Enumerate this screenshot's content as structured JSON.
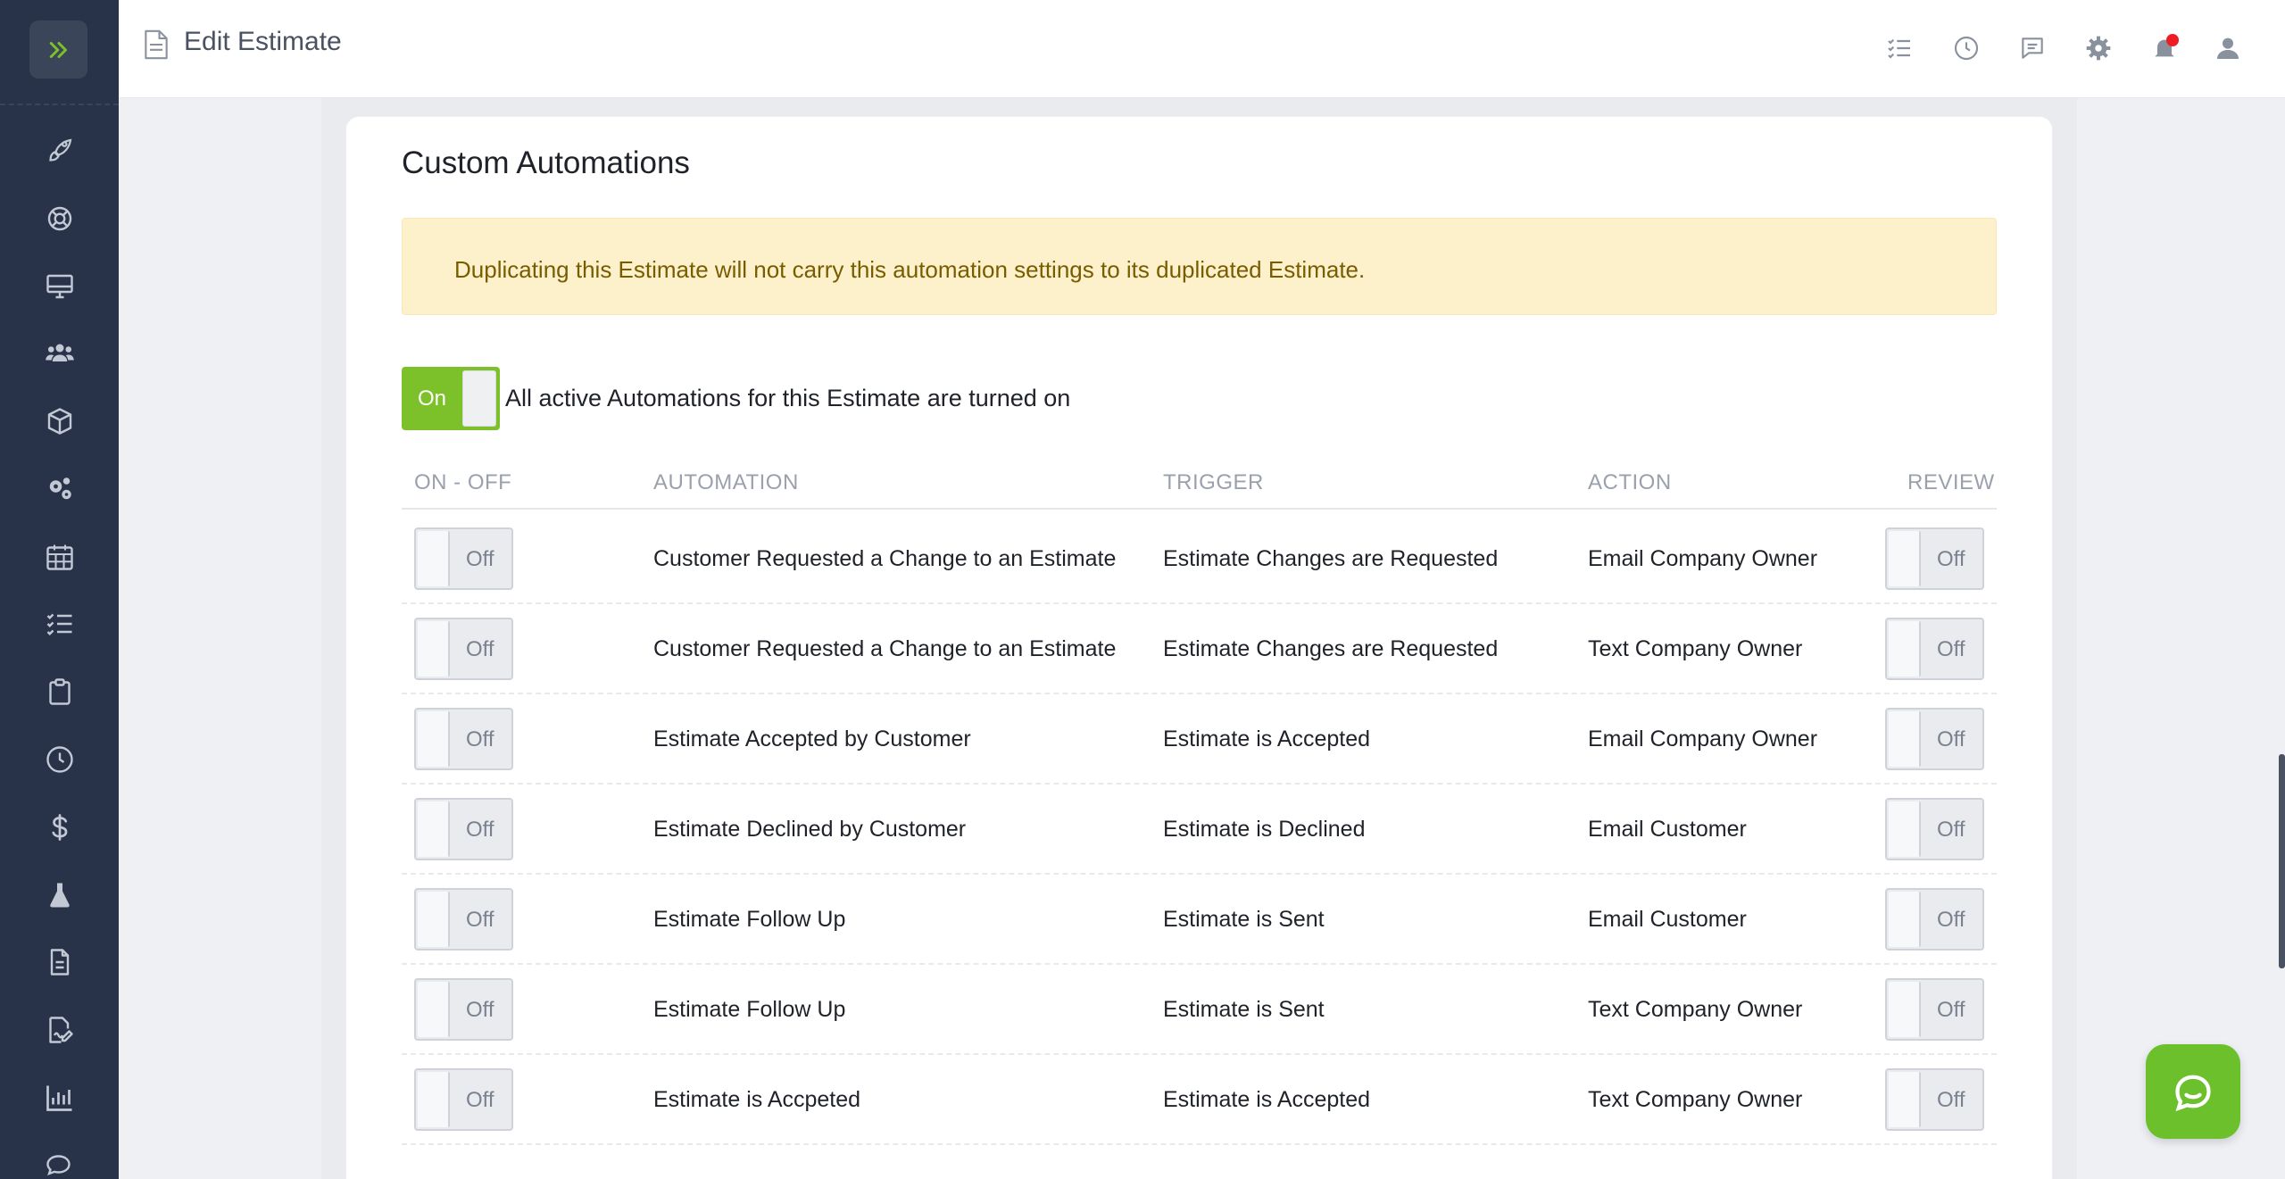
{
  "header": {
    "title": "Edit Estimate",
    "icons": [
      "checklist-icon",
      "history-icon",
      "chat-icon",
      "settings-icon",
      "bell-icon",
      "user-icon"
    ]
  },
  "sidebar": {
    "items": [
      "expand-icon",
      "rocket-icon",
      "lifebuoy-icon",
      "monitor-icon",
      "users-icon",
      "box-icon",
      "gears-icon",
      "calendar-icon",
      "tasks-icon",
      "clipboard-icon",
      "clock-icon",
      "dollar-icon",
      "flask-icon",
      "document-icon",
      "signature-icon",
      "chart-icon",
      "comments-icon"
    ]
  },
  "section": {
    "title": "Custom Automations",
    "alert": "Duplicating this Estimate will not carry this automation settings to its duplicated Estimate.",
    "master_toggle_label": "On",
    "master_text": "All active Automations for this Estimate are turned on"
  },
  "table": {
    "headers": {
      "onoff": "ON - OFF",
      "automation": "AUTOMATION",
      "trigger": "TRIGGER",
      "action": "ACTION",
      "review": "REVIEW"
    },
    "rows": [
      {
        "toggle": "Off",
        "automation": "Customer Requested a Change to an Estimate",
        "trigger": "Estimate Changes are Requested",
        "action": "Email Company Owner",
        "review": "Off"
      },
      {
        "toggle": "Off",
        "automation": "Customer Requested a Change to an Estimate",
        "trigger": "Estimate Changes are Requested",
        "action": "Text Company Owner",
        "review": "Off"
      },
      {
        "toggle": "Off",
        "automation": "Estimate Accepted by Customer",
        "trigger": "Estimate is Accepted",
        "action": "Email Company Owner",
        "review": "Off"
      },
      {
        "toggle": "Off",
        "automation": "Estimate Declined by Customer",
        "trigger": "Estimate is Declined",
        "action": "Email Customer",
        "review": "Off"
      },
      {
        "toggle": "Off",
        "automation": "Estimate Follow Up",
        "trigger": "Estimate is Sent",
        "action": "Email Customer",
        "review": "Off"
      },
      {
        "toggle": "Off",
        "automation": "Estimate Follow Up",
        "trigger": "Estimate is Sent",
        "action": "Text Company Owner",
        "review": "Off"
      },
      {
        "toggle": "Off",
        "automation": "Estimate is Accpeted",
        "trigger": "Estimate is Accepted",
        "action": "Text Company Owner",
        "review": "Off"
      }
    ]
  },
  "colors": {
    "accent": "#7cc12a",
    "sidebar": "#283249",
    "alert_bg": "#fdf1cc",
    "alert_text": "#7a5c00",
    "notification": "#ee1c24"
  }
}
